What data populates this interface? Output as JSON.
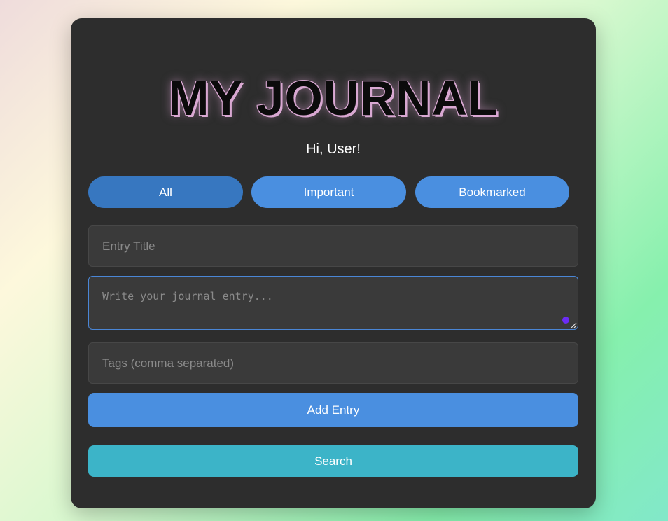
{
  "header": {
    "title": "MY JOURNAL",
    "greeting": "Hi, User!"
  },
  "filters": [
    {
      "label": "All",
      "active": true
    },
    {
      "label": "Important",
      "active": false
    },
    {
      "label": "Bookmarked",
      "active": false
    }
  ],
  "form": {
    "title_placeholder": "Entry Title",
    "title_value": "",
    "entry_placeholder": "Write your journal entry...",
    "entry_value": "",
    "tags_placeholder": "Tags (comma separated)",
    "tags_value": ""
  },
  "actions": {
    "add_label": "Add Entry",
    "search_label": "Search"
  },
  "colors": {
    "card_bg": "#2d2d2d",
    "primary": "#4a8fe0",
    "primary_active": "#3777c0",
    "search": "#3cb4c8",
    "title_glow": "#d9a8d2"
  }
}
